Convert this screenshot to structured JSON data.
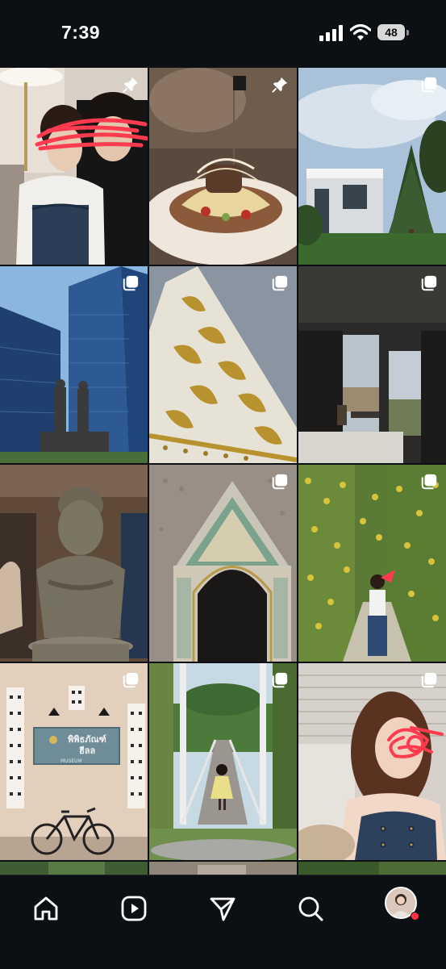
{
  "status_bar": {
    "time": "7:39",
    "battery_level": "48"
  },
  "grid": {
    "tiles": [
      {
        "subject": "couple selfie, face scribbled out",
        "badge": "pin-icon"
      },
      {
        "subject": "plated dish with flag pick",
        "badge": "pin-icon"
      },
      {
        "subject": "white modern house with pine tree",
        "badge": "carousel-icon"
      },
      {
        "subject": "glass skyscraper with statues",
        "badge": "carousel-icon"
      },
      {
        "subject": "ornate white and gold stupa detail",
        "badge": "carousel-icon"
      },
      {
        "subject": "hotel room with river view",
        "badge": "carousel-icon"
      },
      {
        "subject": "bronze buddha bust sculpture",
        "badge": "none"
      },
      {
        "subject": "ornate temple gate",
        "badge": "carousel-icon"
      },
      {
        "subject": "woman by yellow flower wall",
        "badge": "carousel-icon"
      },
      {
        "subject": "museum wall with sign and bicycle",
        "badge": "carousel-icon"
      },
      {
        "subject": "girl on suspension bridge",
        "badge": "carousel-icon"
      },
      {
        "subject": "woman in denim, face scribbled out",
        "badge": "carousel-icon"
      }
    ],
    "museum_sign": {
      "line1": "พิพิธภัณฑ์",
      "line2": "ฮีลล",
      "line3": "MUSEUM"
    }
  },
  "bottom_nav": {
    "items": [
      "home-icon",
      "reels-icon",
      "messages-icon",
      "search-icon",
      "profile-avatar"
    ],
    "active": "profile-avatar",
    "notification": true
  },
  "colors": {
    "background": "#0c1014",
    "notification": "#ff3040",
    "scribble": "#ff3b4f"
  }
}
